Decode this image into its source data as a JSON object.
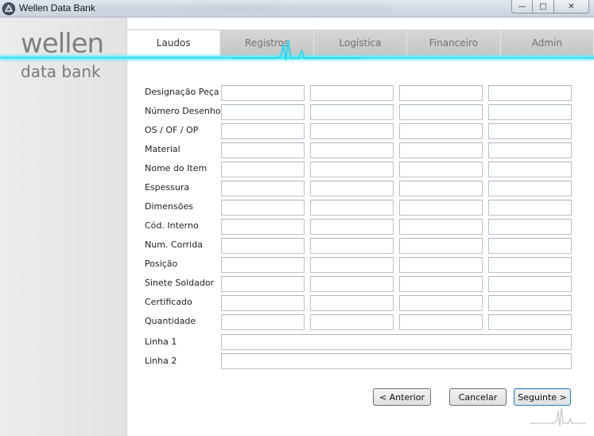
{
  "window": {
    "title": "Wellen Data Bank",
    "minimize_glyph": "—",
    "maximize_glyph": "□",
    "close_glyph": "✕"
  },
  "logo": {
    "top": "wellen",
    "bottom": "data bank",
    "accent_color": "#31d9ef"
  },
  "tabs": [
    {
      "label": "Laudos",
      "active": true
    },
    {
      "label": "Registros",
      "active": false
    },
    {
      "label": "Logística",
      "active": false
    },
    {
      "label": "Financeiro",
      "active": false
    },
    {
      "label": "Admin",
      "active": false
    }
  ],
  "form": {
    "rows": [
      {
        "label": "Designação Peça",
        "kind": "text",
        "values": [
          "",
          "",
          "",
          ""
        ]
      },
      {
        "label": "Número Desenho",
        "kind": "text",
        "values": [
          "",
          "",
          "",
          ""
        ]
      },
      {
        "label": "OS / OF / OP",
        "kind": "text",
        "values": [
          "",
          "",
          "",
          ""
        ]
      },
      {
        "label": "Material",
        "kind": "combo",
        "values": [
          "",
          "",
          "",
          ""
        ]
      },
      {
        "label": "Nome do Item",
        "kind": "combo",
        "values": [
          "",
          "",
          "",
          ""
        ]
      },
      {
        "label": "Espessura",
        "kind": "text",
        "values": [
          "",
          "",
          "",
          ""
        ]
      },
      {
        "label": "Dimensões",
        "kind": "text",
        "values": [
          "",
          "",
          "",
          ""
        ]
      },
      {
        "label": "Cód. Interno",
        "kind": "text",
        "values": [
          "",
          "",
          "",
          ""
        ]
      },
      {
        "label": "Num. Corrida",
        "kind": "text",
        "values": [
          "",
          "",
          "",
          ""
        ]
      },
      {
        "label": "Posição",
        "kind": "text",
        "values": [
          "",
          "",
          "",
          ""
        ]
      },
      {
        "label": "Sinete Soldador",
        "kind": "text",
        "values": [
          "",
          "",
          "",
          ""
        ]
      },
      {
        "label": "Certificado",
        "kind": "text",
        "values": [
          "",
          "",
          "",
          ""
        ]
      },
      {
        "label": "Quantidade",
        "kind": "text",
        "values": [
          "",
          "",
          "",
          ""
        ]
      }
    ],
    "lines": [
      {
        "label": "Linha 1",
        "value": ""
      },
      {
        "label": "Linha 2",
        "value": ""
      }
    ]
  },
  "buttons": {
    "previous": "< Anterior",
    "cancel": "Cancelar",
    "next": "Seguinte >"
  }
}
